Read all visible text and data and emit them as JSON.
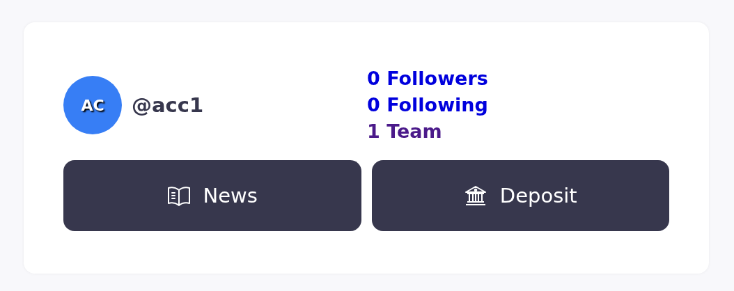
{
  "profile": {
    "avatar_initials": "AC",
    "username": "@acc1"
  },
  "stats": [
    {
      "label": "0 Followers",
      "color": "#0000dd"
    },
    {
      "label": "0 Following",
      "color": "#0000dd"
    },
    {
      "label": "1 Team",
      "color": "#4b1a8a"
    }
  ],
  "buttons": [
    {
      "label": "News",
      "kind": "book"
    },
    {
      "label": "Deposit",
      "kind": "bank"
    }
  ]
}
